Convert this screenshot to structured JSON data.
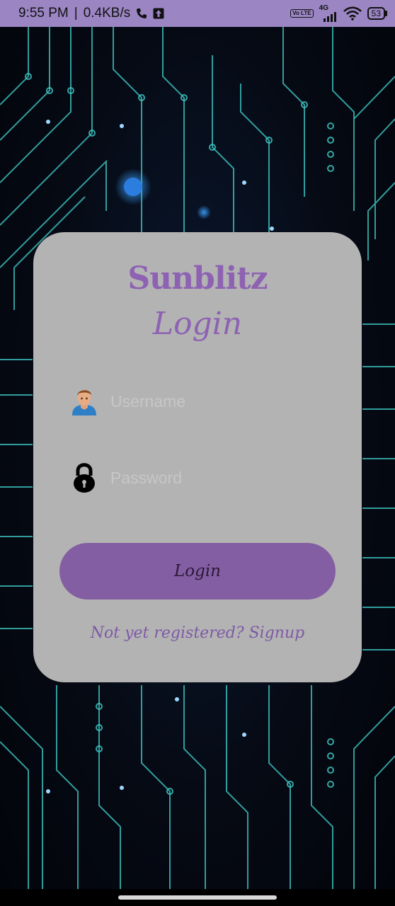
{
  "status_bar": {
    "time": "9:55 PM",
    "separator": "|",
    "net_speed": "0.4KB/s",
    "call_icon": "phone-icon",
    "upload_icon": "upload-arrow-icon",
    "volte_badge": "Vo LTE",
    "network_type": "4G",
    "battery_level": "53"
  },
  "login": {
    "brand": "Sunblitz",
    "title": "Login",
    "username_placeholder": "Username",
    "password_placeholder": "Password",
    "username_icon": "user-avatar-icon",
    "password_icon": "lock-icon",
    "login_button_label": "Login",
    "signup_link": "Not yet registered? Signup"
  },
  "colors": {
    "accent": "#8e62b3",
    "button": "#845ea2",
    "card": "#b3b3b3",
    "status_bar": "#9b86c3"
  }
}
